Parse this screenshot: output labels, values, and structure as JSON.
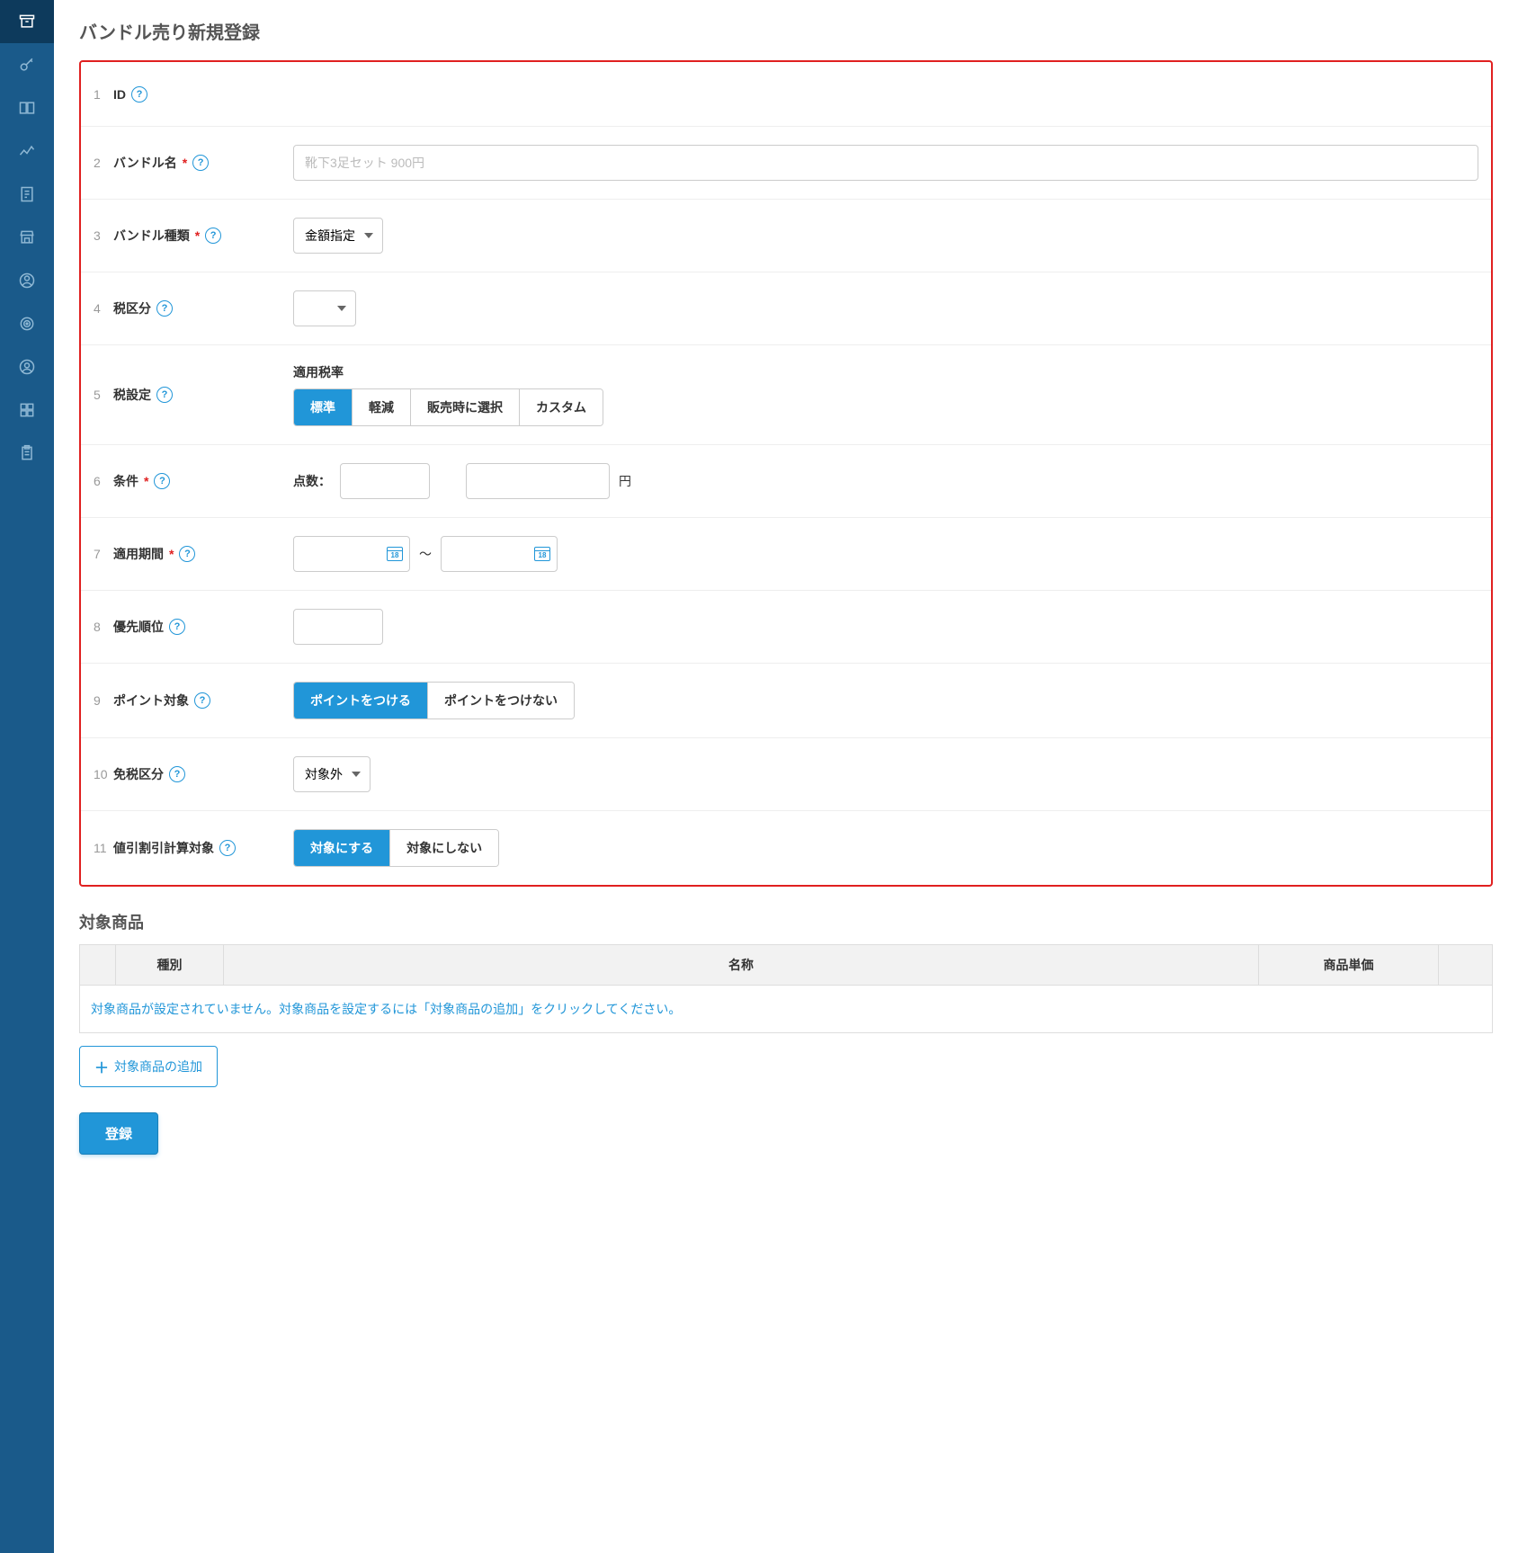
{
  "page_title": "バンドル売り新規登録",
  "rows": {
    "r1": {
      "num": "1",
      "label": "ID"
    },
    "r2": {
      "num": "2",
      "label": "バンドル名",
      "placeholder": "靴下3足セット 900円"
    },
    "r3": {
      "num": "3",
      "label": "バンドル種類",
      "selected": "金額指定"
    },
    "r4": {
      "num": "4",
      "label": "税区分",
      "selected": ""
    },
    "r5": {
      "num": "5",
      "label": "税設定",
      "sub": "適用税率",
      "opts": {
        "a": "標準",
        "b": "軽減",
        "c": "販売時に選択",
        "d": "カスタム"
      }
    },
    "r6": {
      "num": "6",
      "label": "条件",
      "count_label": "点数：",
      "yen": "円"
    },
    "r7": {
      "num": "7",
      "label": "適用期間",
      "sep": "〜",
      "cal_day": "18"
    },
    "r8": {
      "num": "8",
      "label": "優先順位"
    },
    "r9": {
      "num": "9",
      "label": "ポイント対象",
      "opts": {
        "a": "ポイントをつける",
        "b": "ポイントをつけない"
      }
    },
    "r10": {
      "num": "10",
      "label": "免税区分",
      "selected": "対象外"
    },
    "r11": {
      "num": "11",
      "label": "値引割引計算対象",
      "opts": {
        "a": "対象にする",
        "b": "対象にしない"
      }
    }
  },
  "products": {
    "section_title": "対象商品",
    "cols": {
      "type": "種別",
      "name": "名称",
      "price": "商品単価"
    },
    "empty_msg": "対象商品が設定されていません。対象商品を設定するには「対象商品の追加」をクリックしてください。",
    "add_btn": "対象商品の追加"
  },
  "submit": "登録"
}
